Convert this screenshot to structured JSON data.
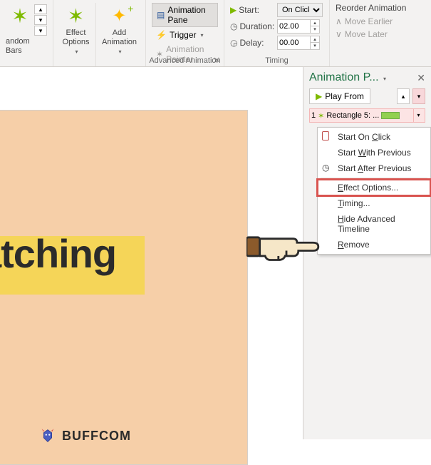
{
  "ribbon": {
    "group_anim": {
      "random_bars": "andom Bars",
      "more_caret": "▾"
    },
    "group_adv": {
      "effect_options": "Effect\nOptions",
      "add_animation": "Add\nAnimation",
      "animation_pane": "Animation Pane",
      "trigger": "Trigger",
      "animation_painter": "Animation Painter",
      "label": "Advanced Animation"
    },
    "group_timing": {
      "start_label": "Start:",
      "start_value": "On Click",
      "duration_label": "Duration:",
      "duration_value": "02.00",
      "delay_label": "Delay:",
      "delay_value": "00.00",
      "label": "Timing"
    },
    "group_reorder": {
      "title": "Reorder Animation",
      "move_earlier": "Move Earlier",
      "move_later": "Move Later"
    }
  },
  "slide": {
    "text": "atching",
    "logo": "BUFFCOM"
  },
  "pane": {
    "title": "Animation P...",
    "play_from": "Play From",
    "item": {
      "num": "1",
      "label": "Rectangle 5: ..."
    }
  },
  "ctx": {
    "start_click": "Start On Click",
    "start_with": "Start With Previous",
    "start_after": "Start After Previous",
    "effect_options": "Effect Options...",
    "timing": "Timing...",
    "hide_timeline": "Hide Advanced Timeline",
    "remove": "Remove",
    "u": {
      "c": "C",
      "w": "W",
      "a": "A",
      "e": "E",
      "t": "T",
      "h": "H",
      "r": "R"
    }
  }
}
